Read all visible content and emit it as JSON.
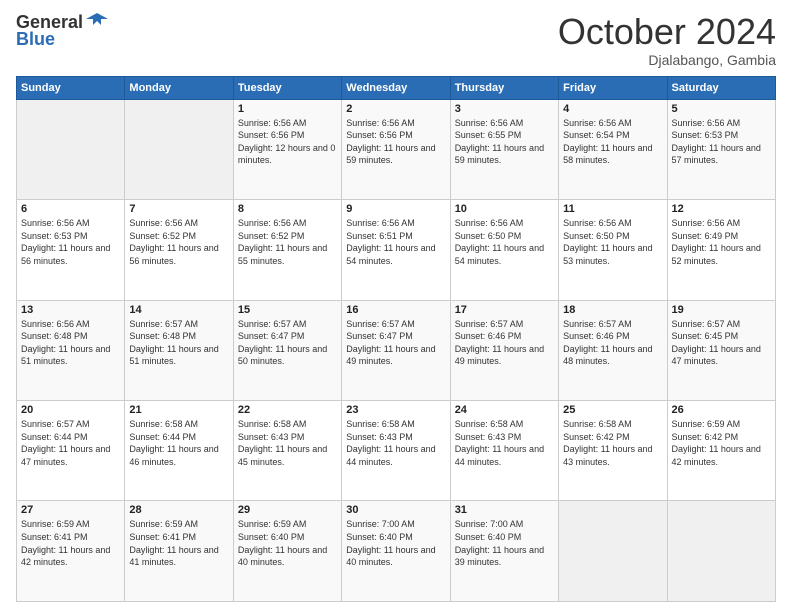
{
  "logo": {
    "general": "General",
    "blue": "Blue"
  },
  "header": {
    "month": "October 2024",
    "location": "Djalabango, Gambia"
  },
  "weekdays": [
    "Sunday",
    "Monday",
    "Tuesday",
    "Wednesday",
    "Thursday",
    "Friday",
    "Saturday"
  ],
  "weeks": [
    [
      {
        "day": "",
        "sunrise": "",
        "sunset": "",
        "daylight": ""
      },
      {
        "day": "",
        "sunrise": "",
        "sunset": "",
        "daylight": ""
      },
      {
        "day": "1",
        "sunrise": "Sunrise: 6:56 AM",
        "sunset": "Sunset: 6:56 PM",
        "daylight": "Daylight: 12 hours and 0 minutes."
      },
      {
        "day": "2",
        "sunrise": "Sunrise: 6:56 AM",
        "sunset": "Sunset: 6:56 PM",
        "daylight": "Daylight: 11 hours and 59 minutes."
      },
      {
        "day": "3",
        "sunrise": "Sunrise: 6:56 AM",
        "sunset": "Sunset: 6:55 PM",
        "daylight": "Daylight: 11 hours and 59 minutes."
      },
      {
        "day": "4",
        "sunrise": "Sunrise: 6:56 AM",
        "sunset": "Sunset: 6:54 PM",
        "daylight": "Daylight: 11 hours and 58 minutes."
      },
      {
        "day": "5",
        "sunrise": "Sunrise: 6:56 AM",
        "sunset": "Sunset: 6:53 PM",
        "daylight": "Daylight: 11 hours and 57 minutes."
      }
    ],
    [
      {
        "day": "6",
        "sunrise": "Sunrise: 6:56 AM",
        "sunset": "Sunset: 6:53 PM",
        "daylight": "Daylight: 11 hours and 56 minutes."
      },
      {
        "day": "7",
        "sunrise": "Sunrise: 6:56 AM",
        "sunset": "Sunset: 6:52 PM",
        "daylight": "Daylight: 11 hours and 56 minutes."
      },
      {
        "day": "8",
        "sunrise": "Sunrise: 6:56 AM",
        "sunset": "Sunset: 6:52 PM",
        "daylight": "Daylight: 11 hours and 55 minutes."
      },
      {
        "day": "9",
        "sunrise": "Sunrise: 6:56 AM",
        "sunset": "Sunset: 6:51 PM",
        "daylight": "Daylight: 11 hours and 54 minutes."
      },
      {
        "day": "10",
        "sunrise": "Sunrise: 6:56 AM",
        "sunset": "Sunset: 6:50 PM",
        "daylight": "Daylight: 11 hours and 54 minutes."
      },
      {
        "day": "11",
        "sunrise": "Sunrise: 6:56 AM",
        "sunset": "Sunset: 6:50 PM",
        "daylight": "Daylight: 11 hours and 53 minutes."
      },
      {
        "day": "12",
        "sunrise": "Sunrise: 6:56 AM",
        "sunset": "Sunset: 6:49 PM",
        "daylight": "Daylight: 11 hours and 52 minutes."
      }
    ],
    [
      {
        "day": "13",
        "sunrise": "Sunrise: 6:56 AM",
        "sunset": "Sunset: 6:48 PM",
        "daylight": "Daylight: 11 hours and 51 minutes."
      },
      {
        "day": "14",
        "sunrise": "Sunrise: 6:57 AM",
        "sunset": "Sunset: 6:48 PM",
        "daylight": "Daylight: 11 hours and 51 minutes."
      },
      {
        "day": "15",
        "sunrise": "Sunrise: 6:57 AM",
        "sunset": "Sunset: 6:47 PM",
        "daylight": "Daylight: 11 hours and 50 minutes."
      },
      {
        "day": "16",
        "sunrise": "Sunrise: 6:57 AM",
        "sunset": "Sunset: 6:47 PM",
        "daylight": "Daylight: 11 hours and 49 minutes."
      },
      {
        "day": "17",
        "sunrise": "Sunrise: 6:57 AM",
        "sunset": "Sunset: 6:46 PM",
        "daylight": "Daylight: 11 hours and 49 minutes."
      },
      {
        "day": "18",
        "sunrise": "Sunrise: 6:57 AM",
        "sunset": "Sunset: 6:46 PM",
        "daylight": "Daylight: 11 hours and 48 minutes."
      },
      {
        "day": "19",
        "sunrise": "Sunrise: 6:57 AM",
        "sunset": "Sunset: 6:45 PM",
        "daylight": "Daylight: 11 hours and 47 minutes."
      }
    ],
    [
      {
        "day": "20",
        "sunrise": "Sunrise: 6:57 AM",
        "sunset": "Sunset: 6:44 PM",
        "daylight": "Daylight: 11 hours and 47 minutes."
      },
      {
        "day": "21",
        "sunrise": "Sunrise: 6:58 AM",
        "sunset": "Sunset: 6:44 PM",
        "daylight": "Daylight: 11 hours and 46 minutes."
      },
      {
        "day": "22",
        "sunrise": "Sunrise: 6:58 AM",
        "sunset": "Sunset: 6:43 PM",
        "daylight": "Daylight: 11 hours and 45 minutes."
      },
      {
        "day": "23",
        "sunrise": "Sunrise: 6:58 AM",
        "sunset": "Sunset: 6:43 PM",
        "daylight": "Daylight: 11 hours and 44 minutes."
      },
      {
        "day": "24",
        "sunrise": "Sunrise: 6:58 AM",
        "sunset": "Sunset: 6:43 PM",
        "daylight": "Daylight: 11 hours and 44 minutes."
      },
      {
        "day": "25",
        "sunrise": "Sunrise: 6:58 AM",
        "sunset": "Sunset: 6:42 PM",
        "daylight": "Daylight: 11 hours and 43 minutes."
      },
      {
        "day": "26",
        "sunrise": "Sunrise: 6:59 AM",
        "sunset": "Sunset: 6:42 PM",
        "daylight": "Daylight: 11 hours and 42 minutes."
      }
    ],
    [
      {
        "day": "27",
        "sunrise": "Sunrise: 6:59 AM",
        "sunset": "Sunset: 6:41 PM",
        "daylight": "Daylight: 11 hours and 42 minutes."
      },
      {
        "day": "28",
        "sunrise": "Sunrise: 6:59 AM",
        "sunset": "Sunset: 6:41 PM",
        "daylight": "Daylight: 11 hours and 41 minutes."
      },
      {
        "day": "29",
        "sunrise": "Sunrise: 6:59 AM",
        "sunset": "Sunset: 6:40 PM",
        "daylight": "Daylight: 11 hours and 40 minutes."
      },
      {
        "day": "30",
        "sunrise": "Sunrise: 7:00 AM",
        "sunset": "Sunset: 6:40 PM",
        "daylight": "Daylight: 11 hours and 40 minutes."
      },
      {
        "day": "31",
        "sunrise": "Sunrise: 7:00 AM",
        "sunset": "Sunset: 6:40 PM",
        "daylight": "Daylight: 11 hours and 39 minutes."
      },
      {
        "day": "",
        "sunrise": "",
        "sunset": "",
        "daylight": ""
      },
      {
        "day": "",
        "sunrise": "",
        "sunset": "",
        "daylight": ""
      }
    ]
  ]
}
